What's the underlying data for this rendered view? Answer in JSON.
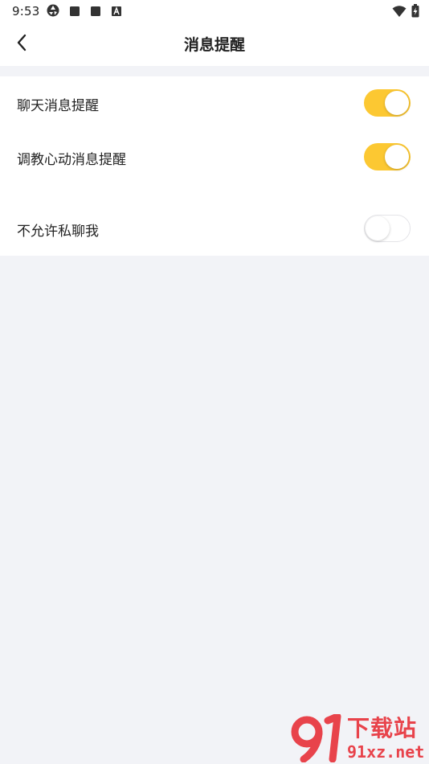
{
  "status_bar": {
    "time": "9:53",
    "left_icons": [
      "aperture-icon",
      "notification-square-icon",
      "notification-square-icon",
      "a-badge-icon"
    ],
    "right_icons": [
      "wifi-icon",
      "battery-charging-icon"
    ]
  },
  "app_bar": {
    "back_icon": "chevron-left-icon",
    "title": "消息提醒"
  },
  "settings": [
    {
      "label": "聊天消息提醒",
      "enabled": true
    },
    {
      "label": "调教心动消息提醒",
      "enabled": true
    },
    {
      "label": "不允许私聊我",
      "enabled": false
    }
  ],
  "watermark": {
    "logo_text": "91",
    "cn_text": "下载站",
    "url_text": "91xz.net"
  },
  "colors": {
    "accent": "#fcc832",
    "background": "#f2f3f7",
    "surface": "#ffffff",
    "text": "#222222",
    "watermark": "#e8434b"
  }
}
